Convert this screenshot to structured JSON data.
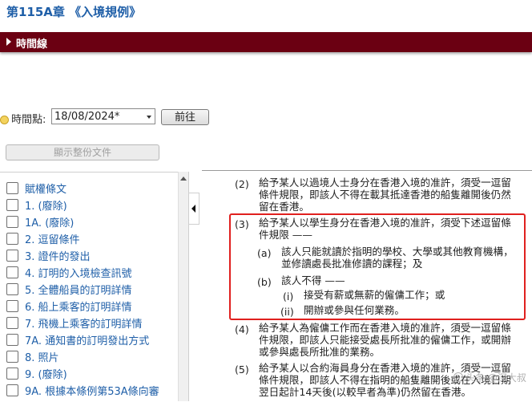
{
  "header": {
    "title": "第115A章 《入境規例》"
  },
  "timeline": {
    "label": "時間線"
  },
  "point_in_time": {
    "label": "時間點:",
    "date_value": "18/08/2024*",
    "go_label": "前往",
    "show_full_label": "顯示整份文件"
  },
  "sidebar": {
    "items": [
      {
        "label": "賦權條文"
      },
      {
        "label": "1. (廢除)"
      },
      {
        "label": "1A. (廢除)"
      },
      {
        "label": "2. 逗留條件"
      },
      {
        "label": "3. 證件的發出"
      },
      {
        "label": "4. 訂明的入境檢查訊號"
      },
      {
        "label": "5. 全體船員的訂明詳情"
      },
      {
        "label": "6. 船上乘客的訂明詳情"
      },
      {
        "label": "7. 飛機上乘客的訂明詳情"
      },
      {
        "label": "7A. 通知書的訂明發出方式"
      },
      {
        "label": "8. 照片"
      },
      {
        "label": "9. (廢除)"
      },
      {
        "label": "9A. 根據本條例第53A條向審"
      }
    ]
  },
  "content": {
    "p2": {
      "num": "(2)",
      "lines": [
        "給予某人以過境人士身分在香港入境的准許，須受一逗留",
        "條件規限，即該人不得在載其抵達香港的船隻離開後仍然",
        "留在香港。"
      ]
    },
    "p3": {
      "num": "(3)",
      "lines": [
        "給予某人以學生身分在香港入境的准許，須受下述逗留條",
        "件規限 ——"
      ]
    },
    "p3a": {
      "num": "(a)",
      "lines": [
        "該人只能就讀於指明的學校、大學或其他教育機構，",
        "並修讀處長批准修讀的課程；及"
      ]
    },
    "p3b": {
      "num": "(b)",
      "lines": [
        "該人不得 ——"
      ]
    },
    "p3bi": {
      "num": "(i)",
      "lines": [
        "接受有薪或無薪的僱傭工作；或"
      ]
    },
    "p3bii": {
      "num": "(ii)",
      "lines": [
        "開辦或參與任何業務。"
      ]
    },
    "p4": {
      "num": "(4)",
      "lines": [
        "給予某人為僱傭工作而在香港入境的准許，須受一逗留條",
        "件規限，即該人只能接受處長所批准的僱傭工作，或開辦",
        "或參與處長所批准的業務。"
      ]
    },
    "p5": {
      "num": "(5)",
      "lines": [
        "給予某人以合約海員身分在香港入境的准許，須受一逗留",
        "條件規限，即該人不得在指明的船隻離開後或在入境日期",
        "翌日起計14天後(以較早者為準)仍然留在香港。"
      ]
    }
  },
  "watermark": {
    "text": "头条 @深大叔"
  },
  "colors": {
    "title_blue": "#1f5fa8",
    "timeline_bar": "#6b0012",
    "highlight_red": "#e0201e"
  }
}
